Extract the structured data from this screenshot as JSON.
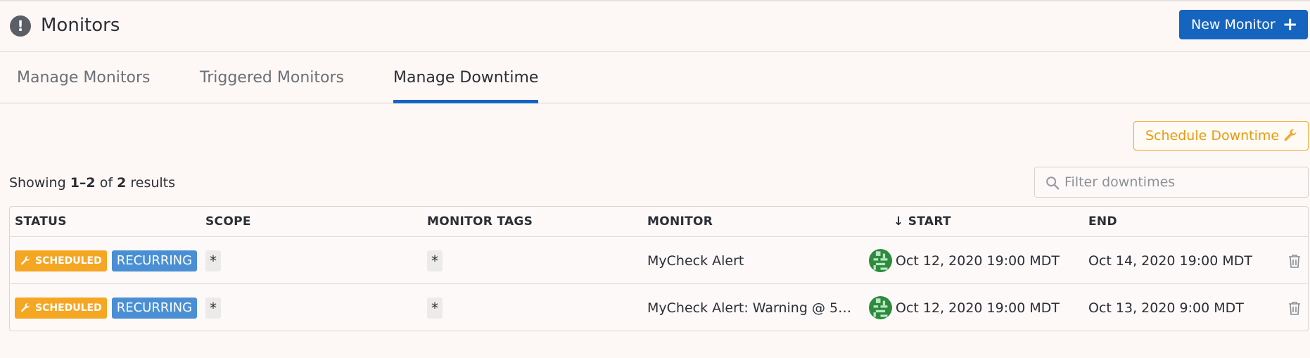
{
  "header": {
    "title": "Monitors",
    "new_monitor_label": "New Monitor"
  },
  "tabs": [
    {
      "label": "Manage Monitors",
      "active": false
    },
    {
      "label": "Triggered Monitors",
      "active": false
    },
    {
      "label": "Manage Downtime",
      "active": true
    }
  ],
  "toolbar": {
    "schedule_label": "Schedule Downtime",
    "showing_prefix": "Showing",
    "showing_range": "1–2",
    "showing_of": "of",
    "showing_total": "2",
    "showing_suffix": "results",
    "filter_placeholder": "Filter downtimes"
  },
  "table": {
    "columns": {
      "status": "STATUS",
      "scope": "SCOPE",
      "monitor_tags": "MONITOR TAGS",
      "monitor": "MONITOR",
      "start": "START",
      "end": "END"
    },
    "sort_indicator": "↓",
    "rows": [
      {
        "status": "SCHEDULED",
        "recurring": "RECURRING",
        "scope": "*",
        "monitor_tags": "*",
        "monitor": "MyCheck Alert",
        "start": "Oct 12, 2020 19:00 MDT",
        "end": "Oct 14, 2020 19:00 MDT"
      },
      {
        "status": "SCHEDULED",
        "recurring": "RECURRING",
        "scope": "*",
        "monitor_tags": "*",
        "monitor": "MyCheck Alert: Warning @ 5…",
        "start": "Oct 12, 2020 19:00 MDT",
        "end": "Oct 13, 2020 9:00 MDT"
      }
    ]
  },
  "colors": {
    "primary": "#1565c0",
    "scheduled_badge": "#f5a623",
    "recurring_badge": "#4a8fd4",
    "schedule_button_text": "#e89b12"
  },
  "icons": {
    "header": "exclamation-circle-icon",
    "new_monitor": "plus-icon",
    "schedule": "wrench-icon",
    "filter": "search-icon",
    "row_action": "trash-icon",
    "creator": "avatar"
  }
}
